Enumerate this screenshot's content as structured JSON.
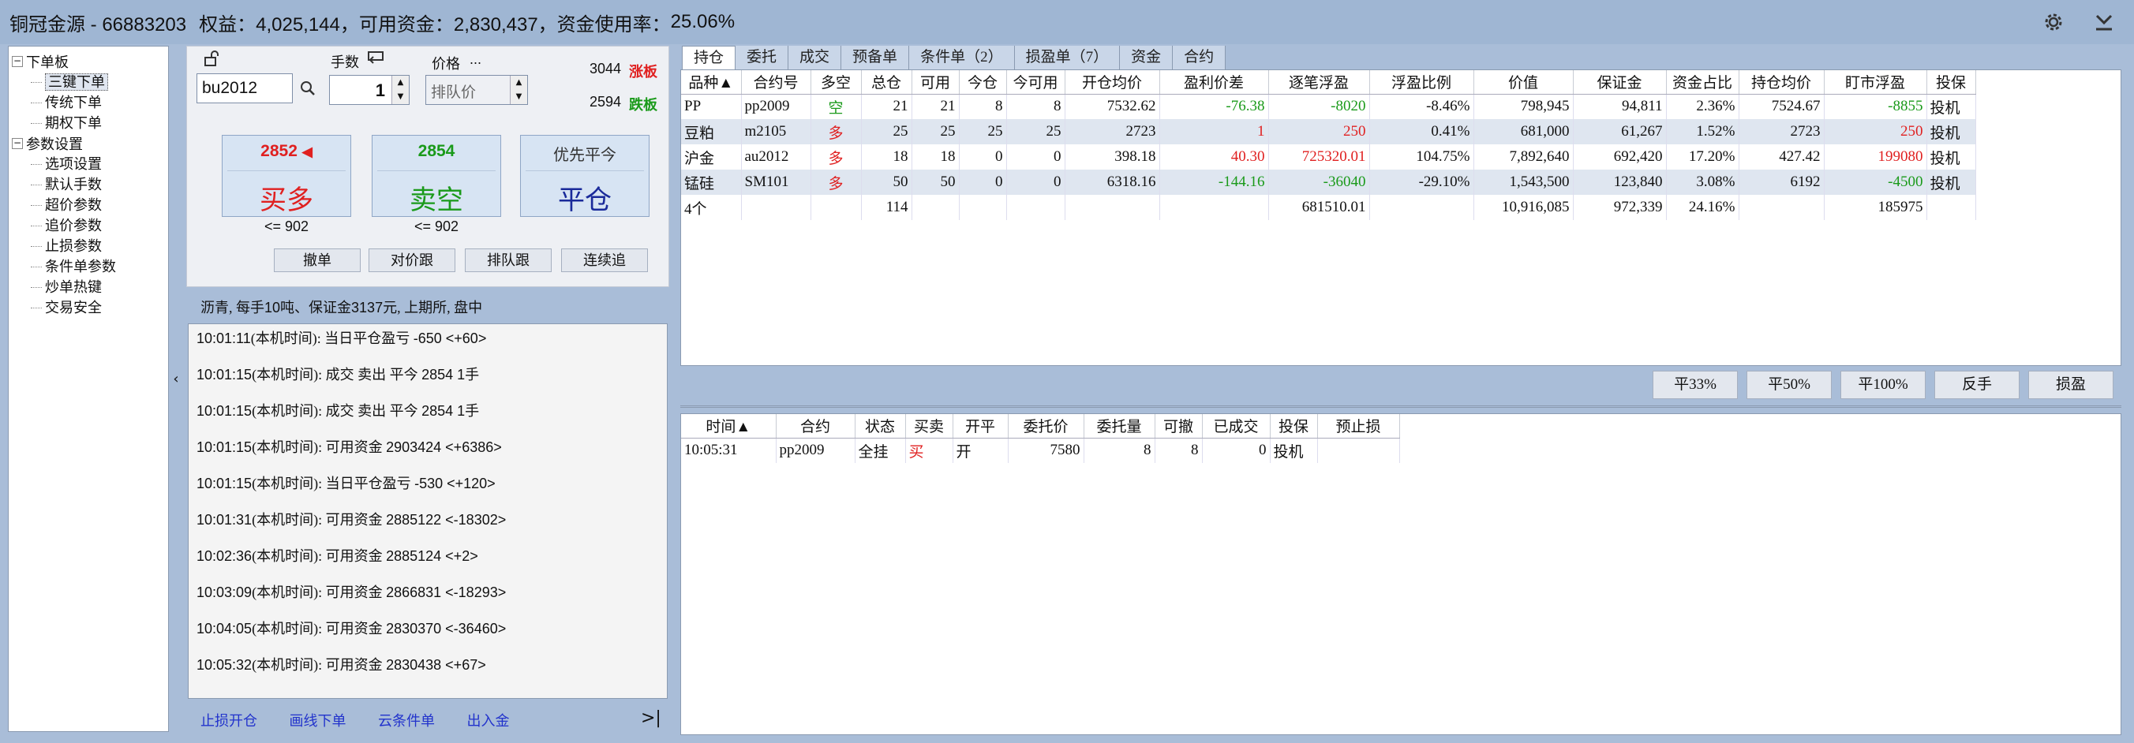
{
  "titlebar": {
    "account": "铜冠金源 - 66883203",
    "equity_label": "权益：",
    "equity_value": "4,025,144，",
    "funds_label": "可用资金：",
    "funds_value": "2,830,437，",
    "usage_label": "资金使用率：",
    "usage_value": "25.06%",
    "icons": [
      "gear-icon",
      "minimize-icon"
    ]
  },
  "tree": {
    "groups": [
      {
        "label": "下单板",
        "toggle": "−",
        "items": [
          "三键下单",
          "传统下单",
          "期权下单"
        ],
        "selected": 0
      },
      {
        "label": "参数设置",
        "toggle": "−",
        "items": [
          "选项设置",
          "默认手数",
          "超价参数",
          "追价参数",
          "止损参数",
          "条件单参数",
          "炒单热键",
          "交易安全"
        ]
      }
    ]
  },
  "order": {
    "lots_label": "手数",
    "price_label": "价格",
    "price_dots": "...",
    "contract": "bu2012",
    "lots": "1",
    "price_placeholder": "排队价",
    "limit_up": "3044",
    "limit_up_label": "涨板",
    "limit_down": "2594",
    "limit_down_label": "跌板",
    "buy_price": "2852",
    "buy_arrow": "◀",
    "buy_label": "买多",
    "sell_price": "2854",
    "sell_label": "卖空",
    "close_top": "优先平今",
    "close_label": "平仓",
    "buy_limit": "<= 902",
    "sell_limit": "<= 902",
    "buttons": [
      "撤单",
      "对价跟",
      "排队跟",
      "连续追"
    ]
  },
  "contract_info": {
    "prefix": "沥青,  每手",
    "lot_num": "10",
    "mid": "吨、保证金",
    "margin": "3137",
    "suffix": "元,  上期所,  盘中"
  },
  "log": [
    {
      "time": "10:01:11",
      "local": "(本机时间)",
      "text": ": 当日平仓盈亏 ",
      "num": "-650  <+60>"
    },
    {
      "time": "10:01:15",
      "local": "(本机时间)",
      "text": ": 成交  卖出  平今  ",
      "num": "2854  1",
      "tail": "手"
    },
    {
      "time": "10:01:15",
      "local": "(本机时间)",
      "text": ": 成交  卖出  平今  ",
      "num": "2854  1",
      "tail": "手"
    },
    {
      "time": "10:01:15",
      "local": "(本机时间)",
      "text": ": 可用资金 ",
      "num": "2903424  <+6386>"
    },
    {
      "time": "10:01:15",
      "local": "(本机时间)",
      "text": ": 当日平仓盈亏 ",
      "num": "-530  <+120>"
    },
    {
      "time": "10:01:31",
      "local": "(本机时间)",
      "text": ": 可用资金 ",
      "num": "2885122  <-18302>"
    },
    {
      "time": "10:02:36",
      "local": "(本机时间)",
      "text": ": 可用资金 ",
      "num": "2885124  <+2>"
    },
    {
      "time": "10:03:09",
      "local": "(本机时间)",
      "text": ": 可用资金 ",
      "num": "2866831  <-18293>"
    },
    {
      "time": "10:04:05",
      "local": "(本机时间)",
      "text": ": 可用资金 ",
      "num": "2830370  <-36460>"
    },
    {
      "time": "10:05:32",
      "local": "(本机时间)",
      "text": ": 可用资金 ",
      "num": "2830438  <+67>"
    }
  ],
  "bottom_links": [
    "止损开仓",
    "画线下单",
    "云条件单",
    "出入金"
  ],
  "collapse_glyph": "‹",
  "expand_glyph": ">|",
  "tabs": [
    "持仓",
    "委托",
    "成交",
    "预备单",
    "条件单（2）",
    "损盈单（7）",
    "资金",
    "合约"
  ],
  "positions": {
    "headers": [
      "品种▲",
      "合约号",
      "多空",
      "总仓",
      "可用",
      "今仓",
      "今可用",
      "开仓均价",
      "盈利价差",
      "逐笔浮盈",
      "浮盈比例",
      "价值",
      "保证金",
      "资金占比",
      "持仓均价",
      "盯市浮盈",
      "投保"
    ],
    "rows": [
      [
        "PP",
        "pp2009",
        "空",
        "21",
        "21",
        "8",
        "8",
        "7532.62",
        "-76.38",
        "-8020",
        "-8.46%",
        "798,945",
        "94,811",
        "2.36%",
        "7524.67",
        "-8855",
        "投机"
      ],
      [
        "豆粕",
        "m2105",
        "多",
        "25",
        "25",
        "25",
        "25",
        "2723",
        "1",
        "250",
        "0.41%",
        "681,000",
        "61,267",
        "1.52%",
        "2723",
        "250",
        "投机"
      ],
      [
        "沪金",
        "au2012",
        "多",
        "18",
        "18",
        "0",
        "0",
        "398.18",
        "40.30",
        "725320.01",
        "104.75%",
        "7,892,640",
        "692,420",
        "17.20%",
        "427.42",
        "199080",
        "投机"
      ],
      [
        "锰硅",
        "SM101",
        "多",
        "50",
        "50",
        "0",
        "0",
        "6318.16",
        "-144.16",
        "-36040",
        "-29.10%",
        "1,543,500",
        "123,840",
        "3.08%",
        "6192",
        "-4500",
        "投机"
      ]
    ],
    "total": [
      "4个",
      "",
      "",
      "114",
      "",
      "",
      "",
      "",
      "",
      "681510.01",
      "",
      "10,916,085",
      "972,339",
      "24.16%",
      "",
      "185975",
      ""
    ]
  },
  "position_actions": [
    "平33%",
    "平50%",
    "平100%",
    "反手",
    "损盈"
  ],
  "orders": {
    "headers": [
      "时间▲",
      "合约",
      "状态",
      "买卖",
      "开平",
      "委托价",
      "委托量",
      "可撤",
      "已成交",
      "投保",
      "预止损"
    ],
    "rows": [
      [
        "10:05:31",
        "pp2009",
        "全挂",
        "买",
        "开",
        "7580",
        "8",
        "8",
        "0",
        "投机",
        ""
      ]
    ]
  },
  "colors": {
    "up": "#e02020",
    "down": "#1a9a1a",
    "title_bg": "#9fb6d3",
    "link": "#2233cc"
  }
}
